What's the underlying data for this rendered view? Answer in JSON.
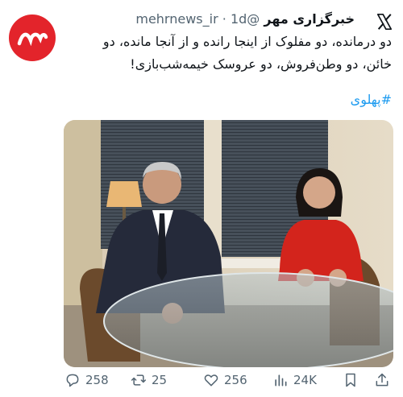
{
  "account": {
    "name": "خبرگزاری مهر",
    "handle": "@mehrnews_ir",
    "separator": "·",
    "time": "1d"
  },
  "tweet": {
    "lines": [
      "دو درمانده، دو مفلوک از اینجا رانده و از آنجا مانده، دو",
      "خائن، دو وطن‌فروش، دو عروسک خیمه‌شب‌بازی!"
    ],
    "hashtag": "#پهلوی"
  },
  "actions": {
    "replies": "258",
    "reposts": "25",
    "likes": "256",
    "views": "24K"
  },
  "colors": {
    "avatar_bg": "#e3242b",
    "hashtag": "#1d9bf0",
    "muted": "#536471"
  }
}
